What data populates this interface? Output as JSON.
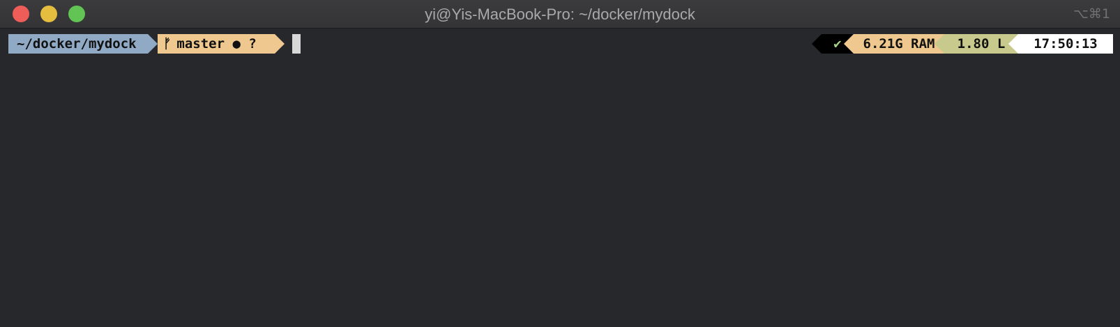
{
  "window": {
    "title": "yi@Yis-MacBook-Pro: ~/docker/mydock",
    "shortcut": "⌥⌘1"
  },
  "prompt": {
    "path": "~/docker/mydock",
    "branch_icon": "ᚠ",
    "git_status": "master ● ?"
  },
  "right_prompt": {
    "status": "✔",
    "ram": "6.21G RAM",
    "load": "1.80 L",
    "time": "17:50:13"
  },
  "colors": {
    "background": "#27282c",
    "path_segment": "#90a9c4",
    "git_segment": "#efc88f",
    "ram_segment": "#efc88f",
    "load_segment": "#c8c98c",
    "time_segment": "#ffffff",
    "status_ok": "#a8d08d"
  }
}
